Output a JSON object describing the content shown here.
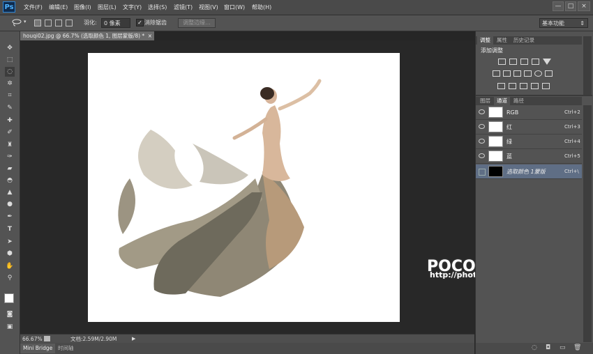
{
  "app": {
    "logo": "Ps"
  },
  "menu": [
    "文件(F)",
    "编辑(E)",
    "图像(I)",
    "图层(L)",
    "文字(Y)",
    "选择(S)",
    "滤镜(T)",
    "视图(V)",
    "窗口(W)",
    "帮助(H)"
  ],
  "window_controls": {
    "minimize": "—",
    "maximize": "□",
    "close": "×"
  },
  "options": {
    "feather_label": "羽化:",
    "feather_value": "0 像素",
    "antialias_label": "消除锯齿",
    "antialias_checked": true,
    "refine_edge": "调整边缘...",
    "workspace": "基本功能"
  },
  "document": {
    "tab_title": "houqi02.jpg @ 66.7% (选取颜色 1, 图层蒙版/8) *",
    "tab_close": "×"
  },
  "status": {
    "zoom": "66.67%",
    "doc_info": "文档:2.59M/2.90M"
  },
  "bottom_tabs": [
    "Mini Bridge",
    "时间轴"
  ],
  "panel_top": {
    "tabs": [
      "调整",
      "属性",
      "历史记录"
    ],
    "title": "添加调整"
  },
  "panel_channels": {
    "tabs": [
      "图层",
      "通道",
      "路径"
    ],
    "channels": [
      {
        "name": "RGB",
        "shortcut": "Ctrl+2"
      },
      {
        "name": "红",
        "shortcut": "Ctrl+3"
      },
      {
        "name": "绿",
        "shortcut": "Ctrl+4"
      },
      {
        "name": "蓝",
        "shortcut": "Ctrl+5"
      },
      {
        "name": "选取颜色 1蒙版",
        "shortcut": "Ctrl+\\"
      }
    ]
  },
  "watermark": {
    "title": "POCO 摄影专题",
    "url": "http://photo.poco.cn/"
  },
  "icons": [
    "lasso-icon",
    "eye-icon",
    "brush-icon",
    "move-tool-icon",
    "zoom-tool-icon",
    "hand-tool-icon",
    "type-tool-icon"
  ],
  "colors": {
    "selected_row": "#5f6e85",
    "foreground": "#ffffff",
    "background": "#000000"
  }
}
